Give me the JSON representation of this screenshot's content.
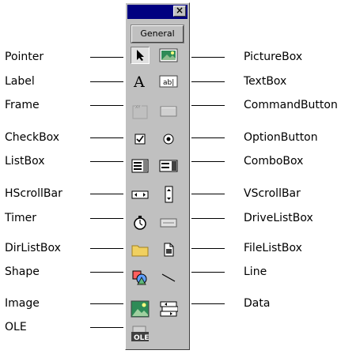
{
  "toolbox": {
    "close_label": "×",
    "tab_label": "General"
  },
  "left_labels": [
    "Pointer",
    "Label",
    "Frame",
    "CheckBox",
    "ListBox",
    "HScrollBar",
    "Timer",
    "DirListBox",
    "Shape",
    "Image",
    "OLE"
  ],
  "right_labels": [
    "PictureBox",
    "TextBox",
    "CommandButton",
    "OptionButton",
    "ComboBox",
    "VScrollBar",
    "DriveListBox",
    "FileListBox",
    "Line",
    "Data"
  ]
}
